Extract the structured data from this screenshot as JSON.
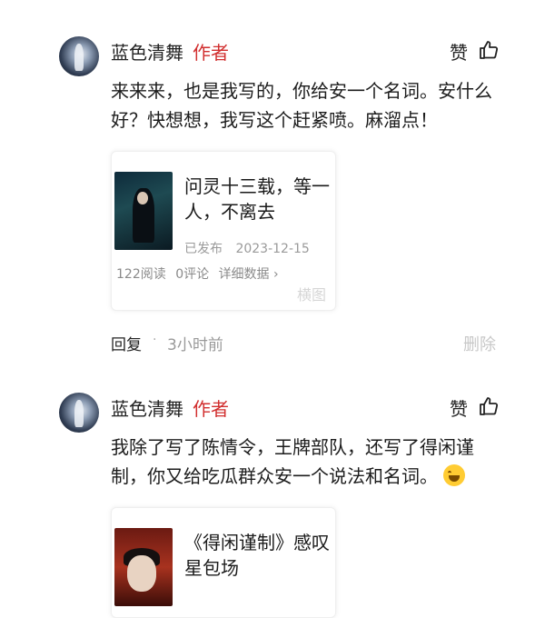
{
  "comments": [
    {
      "username": "蓝色清舞",
      "author_badge": "作者",
      "like_label": "赞",
      "text": "来来来，也是我写的，你给安一个名词。安什么好？快想想，我写这个赶紧喷。麻溜点！",
      "card": {
        "title": "问灵十三载，等一人，不离去",
        "status": "已发布",
        "date": "2023-12-15",
        "reads": "122阅读",
        "comments": "0评论",
        "details": "详细数据 ›",
        "watermark": "横图"
      },
      "reply_label": "回复",
      "dot": "·",
      "time": "3小时前",
      "delete_label": "删除"
    },
    {
      "username": "蓝色清舞",
      "author_badge": "作者",
      "like_label": "赞",
      "text": "我除了写了陈情令，王牌部队，还写了得闲谨制，你又给吃瓜群众安一个说法和名词。",
      "emoji": "laughing-tears-emoji",
      "card": {
        "title": "《得闲谨制》感叹星包场"
      }
    }
  ],
  "colors": {
    "author_badge": "#d12e2e",
    "delete": "#c8c8c8",
    "meta": "#9a9a9a"
  }
}
